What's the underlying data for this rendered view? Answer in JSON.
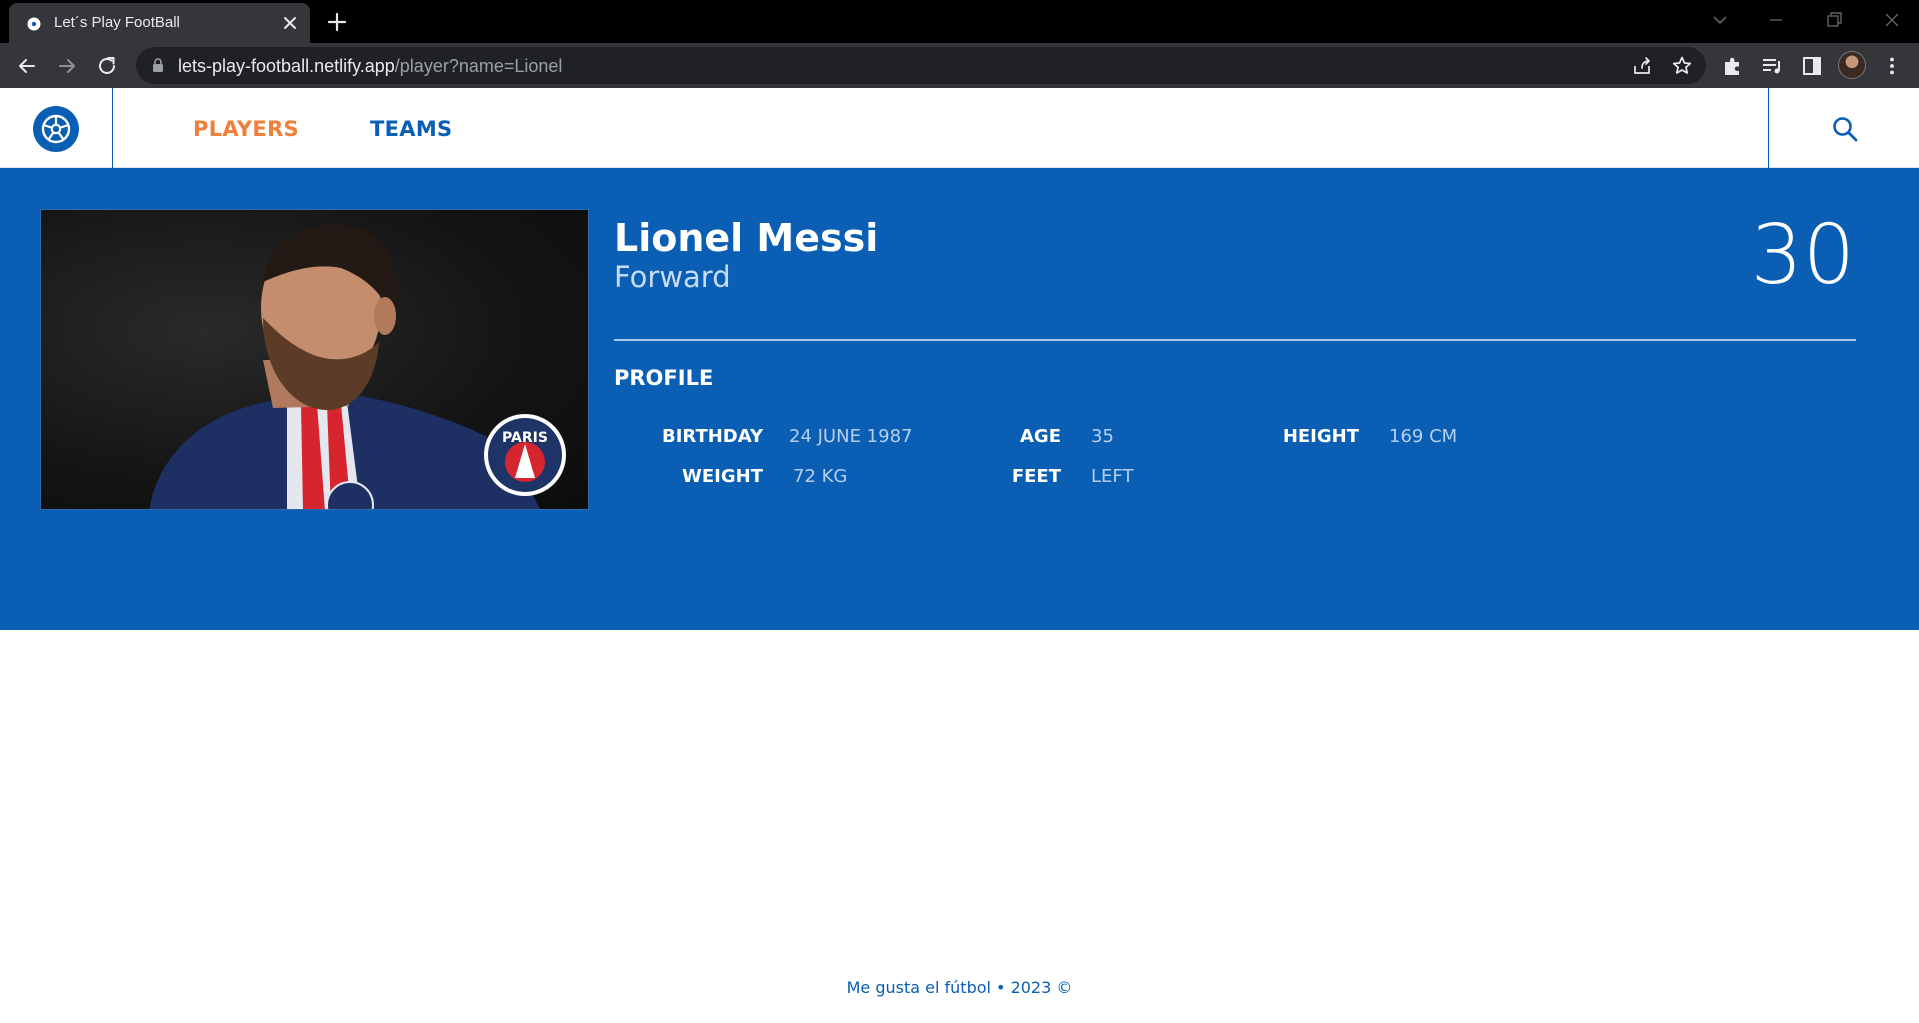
{
  "browser": {
    "tab_title": "Let´s Play FootBall",
    "url_host": "lets-play-football.netlify.app",
    "url_path": "/player?name=Lionel"
  },
  "header": {
    "nav": [
      {
        "label": "PLAYERS",
        "active": true
      },
      {
        "label": "TEAMS",
        "active": false
      }
    ]
  },
  "player": {
    "name": "Lionel Messi",
    "position": "Forward",
    "number": "30",
    "profile_title": "PROFILE",
    "stats": {
      "birthday_label": "BIRTHDAY",
      "birthday": "24 JUNE 1987",
      "age_label": "AGE",
      "age": "35",
      "height_label": "HEIGHT",
      "height": "169 CM",
      "weight_label": "WEIGHT",
      "weight": "72 KG",
      "feet_label": "FEET",
      "feet": "LEFT"
    },
    "photo_badge_text": "PARIS"
  },
  "footer": {
    "text": "Me gusta el fútbol • 2023 ©"
  },
  "colors": {
    "brand_blue": "#0a5fb4",
    "accent_orange": "#ee7f3c"
  }
}
